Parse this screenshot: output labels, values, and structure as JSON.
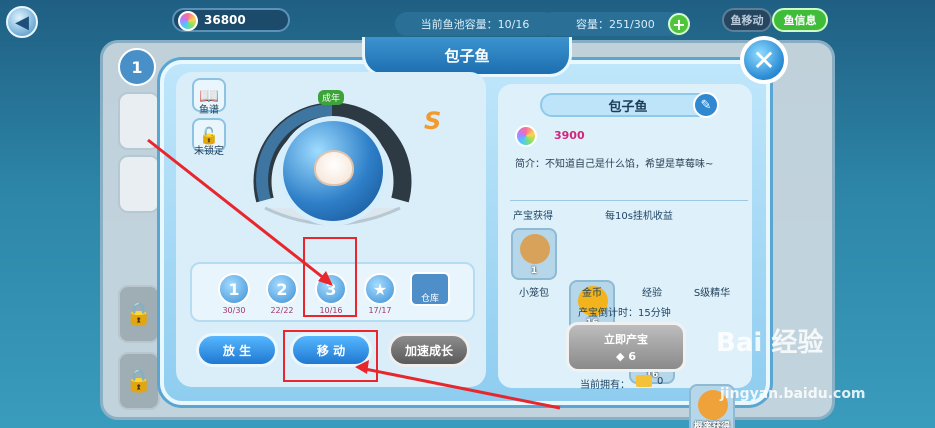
{
  "topbar": {
    "coins": "36800",
    "pool_capacity": "当前鱼池容量：10/16",
    "capacity": "容量：251/300",
    "plus": "+",
    "seg_move": "鱼移动",
    "seg_info": "鱼信息"
  },
  "dialog": {
    "title": "包子鱼",
    "close": "✕"
  },
  "left": {
    "atlas_label": "鱼谱",
    "lock_label": "未锁定",
    "stage_label": "成年",
    "s_badge": "S",
    "stages": [
      {
        "icon": "1",
        "count": "30/30"
      },
      {
        "icon": "2",
        "count": "22/22"
      },
      {
        "icon": "3",
        "count": "10/16"
      },
      {
        "icon": "★",
        "count": "17/17"
      },
      {
        "icon": "仓库",
        "count": ""
      }
    ],
    "buttons": {
      "release": "放 生",
      "move": "移 动",
      "speedup": "加速成长"
    }
  },
  "right": {
    "name": "包子鱼",
    "price": "3900",
    "desc": "简介：不知道自己是什么馅，希望是草莓味~",
    "treasure_label": "产宝获得",
    "income_label": "每10s挂机收益",
    "products": [
      {
        "name": "小笼包",
        "qty": "1",
        "color": "#d9a25a"
      },
      {
        "name": "金币",
        "qty": "16",
        "color": "#f2b31d"
      },
      {
        "name": "经验",
        "qty": "16",
        "color": "#3ab4f2"
      },
      {
        "name": "S级精华",
        "qty": "概率获得",
        "color": "#f0a23a"
      }
    ],
    "countdown": "产宝倒计时：15分钟",
    "produce_label": "立即产宝",
    "produce_cost": "6",
    "owned_label": "当前拥有：",
    "owned_value": "0"
  },
  "watermark": {
    "brand": "Bai  经验",
    "url": "jingyan.baidu.com"
  }
}
